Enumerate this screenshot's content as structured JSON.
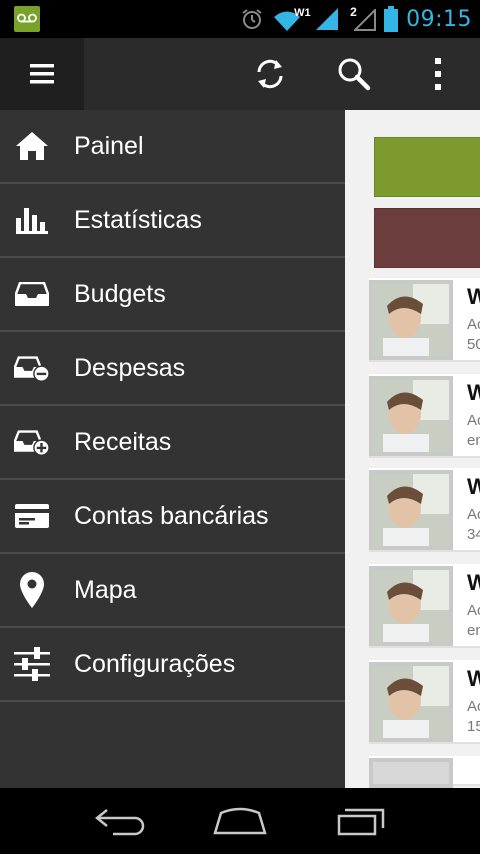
{
  "statusbar": {
    "time": "09:15",
    "voicemail_icon": "voicemail-icon",
    "alarm_icon": "alarm-icon",
    "wifi_label": "W1",
    "signal_sim_label": "2"
  },
  "actionbar": {
    "menu_icon": "hamburger-menu-icon",
    "refresh_icon": "sync-icon",
    "search_icon": "search-icon",
    "overflow_icon": "overflow-menu-icon"
  },
  "drawer": {
    "items": [
      {
        "label": "Painel",
        "icon": "home-icon"
      },
      {
        "label": "Estatísticas",
        "icon": "bar-chart-icon"
      },
      {
        "label": "Budgets",
        "icon": "inbox-tray-icon"
      },
      {
        "label": "Despesas",
        "icon": "tray-minus-icon"
      },
      {
        "label": "Receitas",
        "icon": "tray-plus-icon"
      },
      {
        "label": "Contas bancárias",
        "icon": "credit-card-icon"
      },
      {
        "label": "Mapa",
        "icon": "map-pin-icon"
      },
      {
        "label": "Configurações",
        "icon": "sliders-icon"
      }
    ]
  },
  "content": {
    "colors": {
      "green_bar": "#7d9a2f",
      "red_bar": "#6b3d3d"
    },
    "cards": [
      {
        "name": "W",
        "line2": "Ac",
        "line3": "50"
      },
      {
        "name": "W",
        "line2": "Ac",
        "line3": "en"
      },
      {
        "name": "W",
        "line2": "Ac",
        "line3": "34"
      },
      {
        "name": "W",
        "line2": "Ac",
        "line3": "en"
      },
      {
        "name": "W",
        "line2": "Ac",
        "line3": "15"
      }
    ]
  },
  "navbar": {
    "back_icon": "back-icon",
    "home_icon": "home-button-icon",
    "recents_icon": "recent-apps-icon"
  },
  "accent": "#33b5e5"
}
